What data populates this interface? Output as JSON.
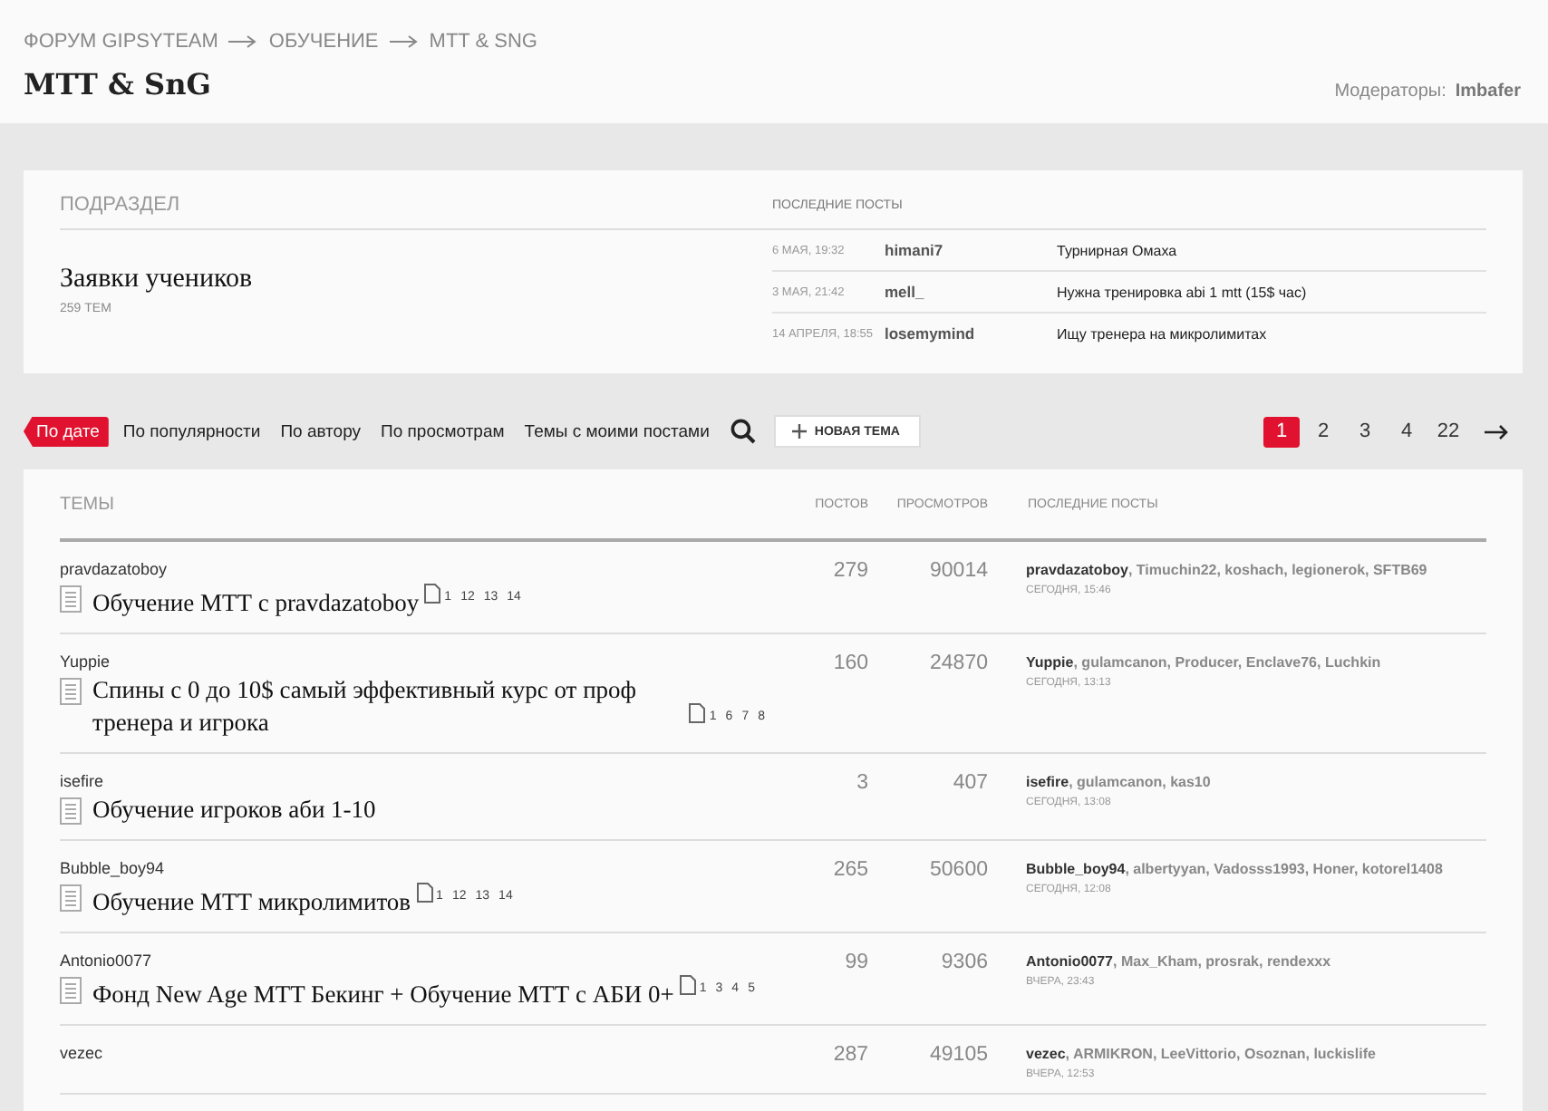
{
  "breadcrumbs": [
    "ФОРУМ GIPSYTEAM",
    "ОБУЧЕНИЕ",
    "MTT & SNG"
  ],
  "title": "MTT & SnG",
  "moderators": {
    "label": "Модераторы:",
    "names": [
      "Imbafer"
    ]
  },
  "subsection": {
    "heading": "ПОДРАЗДЕЛ",
    "name": "Заявки учеников",
    "count": "259 ТЕМ",
    "recent_heading": "ПОСЛЕДНИЕ ПОСТЫ",
    "recent": [
      {
        "date": "6 МАЯ, 19:32",
        "user": "himani7",
        "topic": "Турнирная Омаха"
      },
      {
        "date": "3 МАЯ, 21:42",
        "user": "mell_",
        "topic": "Нужна тренировка abi 1 mtt (15$ час)"
      },
      {
        "date": "14 АПРЕЛЯ, 18:55",
        "user": "losemymind",
        "topic": "Ищу тренера на микролимитах"
      }
    ]
  },
  "sort_tabs": [
    {
      "label": "По дате",
      "selected": true
    },
    {
      "label": "По популярности",
      "selected": false
    },
    {
      "label": "По автору",
      "selected": false
    },
    {
      "label": "По просмотрам",
      "selected": false
    },
    {
      "label": "Темы с моими постами",
      "selected": false
    }
  ],
  "new_topic_button": "НОВАЯ ТЕМА",
  "pagination": [
    {
      "label": "1",
      "selected": true
    },
    {
      "label": "2",
      "selected": false
    },
    {
      "label": "3",
      "selected": false
    },
    {
      "label": "4",
      "selected": false
    },
    {
      "label": "22",
      "selected": false
    }
  ],
  "table": {
    "columns": [
      "ТЕМЫ",
      "ПОСТОВ",
      "ПРОСМОТРОВ",
      "ПОСЛЕДНИЕ ПОСТЫ"
    ],
    "rows": [
      {
        "author": "pravdazatoboy",
        "title": "Обучение МТТ с pravdazatoboy",
        "pages": [
          "1",
          "12",
          "13",
          "14"
        ],
        "posts": "279",
        "views": "90014",
        "last_posters": "**pravdazatoboy**, Timuchin22, koshach, legionerok, SFTB69",
        "last_time": "СЕГОДНЯ, 15:46"
      },
      {
        "author": "Yuppie",
        "title": "Спины с 0 до 10$ самый эффективный курс от проф тренера и игрока",
        "pages": [
          "1",
          "6",
          "7",
          "8"
        ],
        "posts": "160",
        "views": "24870",
        "last_posters": "**Yuppie**, gulamcanon, Producer, Enclave76, Luchkin",
        "last_time": "СЕГОДНЯ, 13:13"
      },
      {
        "author": "isefire",
        "title": "Обучение игроков аби 1-10",
        "pages": [],
        "posts": "3",
        "views": "407",
        "last_posters": "**isefire**, gulamcanon, kas10",
        "last_time": "СЕГОДНЯ, 13:08"
      },
      {
        "author": "Bubble_boy94",
        "title": "Обучение МТТ микролимитов",
        "pages": [
          "1",
          "12",
          "13",
          "14"
        ],
        "posts": "265",
        "views": "50600",
        "last_posters": "**Bubble_boy94**, albertyyan, Vadosss1993, Honer, kotorel1408",
        "last_time": "СЕГОДНЯ, 12:08"
      },
      {
        "author": "Antonio0077",
        "title": "Фонд New Age MTT Бекинг + Обучение МТТ с АБИ 0+",
        "pages": [
          "1",
          "3",
          "4",
          "5"
        ],
        "posts": "99",
        "views": "9306",
        "last_posters": "**Antonio0077**, Max_Kham, prosrak, rendexxx",
        "last_time": "ВЧЕРА, 23:43"
      },
      {
        "author": "vezec",
        "pages": [],
        "posts": "287",
        "views": "49105",
        "last_posters": "**vezec**, ARMIKRON, LeeVittorio, Osoznan, luckislife",
        "last_time": "ВЧЕРА, 12:53"
      }
    ]
  }
}
